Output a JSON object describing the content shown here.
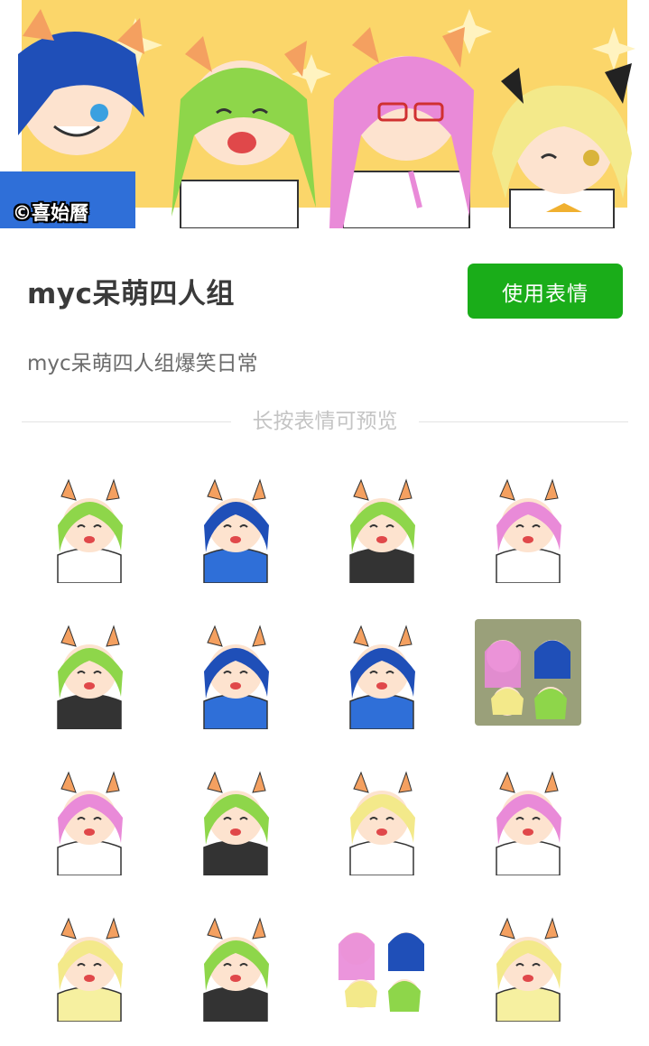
{
  "banner": {
    "copyright": "©喜始曆"
  },
  "pack": {
    "title": "myc呆萌四人组",
    "use_button": "使用表情",
    "description": "myc呆萌四人组爆笑日常"
  },
  "preview_hint": "长按表情可预览",
  "stickers": [
    {
      "name": "green-cat-thank-you",
      "hair": "#8ed64a",
      "shirt": "#ffffff",
      "extra": "#ffffff"
    },
    {
      "name": "blue-cat-thumbs-up",
      "hair": "#1f4fb8",
      "shirt": "#2f6fd8",
      "extra": "#ffffff"
    },
    {
      "name": "green-cat-sweat",
      "hair": "#8ed64a",
      "shirt": "#333333",
      "extra": "#ffffff"
    },
    {
      "name": "pink-cat-question",
      "hair": "#e98ad8",
      "shirt": "#ffffff",
      "extra": "#ffffff"
    },
    {
      "name": "green-cat-silent",
      "hair": "#8ed64a",
      "shirt": "#333333",
      "extra": "#ffffff"
    },
    {
      "name": "blue-cat-pat-head",
      "hair": "#1f4fb8",
      "shirt": "#2f6fd8",
      "extra": "#ffffff"
    },
    {
      "name": "blue-cat-grin",
      "hair": "#1f4fb8",
      "shirt": "#2f6fd8",
      "extra": "#ffffff"
    },
    {
      "name": "group-gloom",
      "hair": "#8ed64a",
      "shirt": "#2f6fd8",
      "extra": "#666666"
    },
    {
      "name": "pink-cat-angry",
      "hair": "#e98ad8",
      "shirt": "#ffffff",
      "extra": "#ffffff"
    },
    {
      "name": "green-cat-kneel",
      "hair": "#8ed64a",
      "shirt": "#333333",
      "extra": "#ffffff"
    },
    {
      "name": "yellow-cat-cry",
      "hair": "#f3e98a",
      "shirt": "#ffffff",
      "extra": "#ffffff"
    },
    {
      "name": "pink-cat-pout",
      "hair": "#e98ad8",
      "shirt": "#ffffff",
      "extra": "#ffffff"
    },
    {
      "name": "yellow-cat-wink",
      "hair": "#f3e98a",
      "shirt": "#f6f0a0",
      "extra": "#ffffff"
    },
    {
      "name": "green-cat-laugh",
      "hair": "#8ed64a",
      "shirt": "#333333",
      "extra": "#ffffff"
    },
    {
      "name": "group-party",
      "hair": "#e98ad8",
      "shirt": "#ffffff",
      "extra": "#ffffff"
    },
    {
      "name": "yellow-cat-wave",
      "hair": "#f3e98a",
      "shirt": "#f6f0a0",
      "extra": "#ffffff"
    }
  ],
  "colors": {
    "accent": "#1aad19",
    "banner_bg": "#fbd66a"
  }
}
